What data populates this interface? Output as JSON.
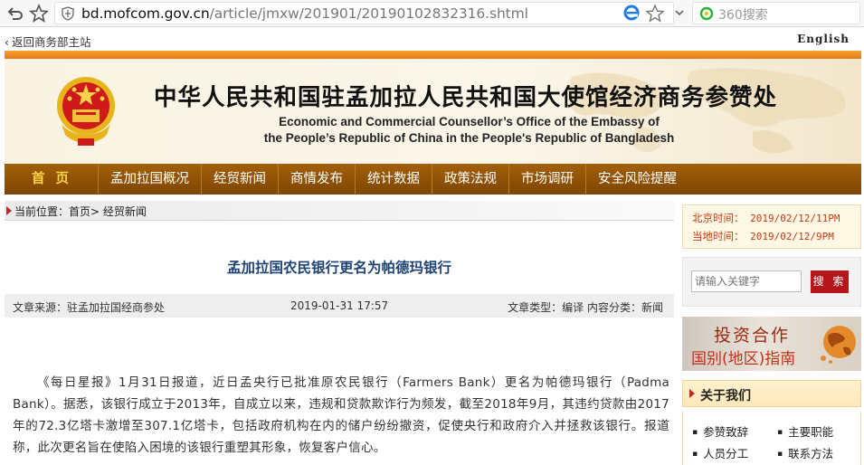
{
  "browser": {
    "url_host": "bd.mofcom.gov.cn",
    "url_path": "/article/jmxw/201901/20190102832316.shtml",
    "search_engine": "360搜索"
  },
  "top_links": {
    "back_home": "返回商务部主站",
    "english": "English"
  },
  "header": {
    "title_cn": "中华人民共和国驻孟加拉人民共和国大使馆经济商务参赞处",
    "title_en_line1": "Economic and Commercial Counsellor’s Office of the Embassy of",
    "title_en_line2": "the People’s Republic of China in the People's Republic of Bangladesh"
  },
  "nav": {
    "items": [
      "首页",
      "孟加拉国概况",
      "经贸新闻",
      "商情发布",
      "统计数据",
      "政策法规",
      "市场调研",
      "安全风险提醒"
    ],
    "active_index": 0,
    "active_color": "#ffd448"
  },
  "breadcrumb": {
    "text": "当前位置：首页> 经贸新闻"
  },
  "article": {
    "title": "孟加拉国农民银行更名为帕德玛银行",
    "source": "文章来源：驻孟加拉国经商参处",
    "date": "2019-01-31  17:57",
    "type": "文章类型：编译  内容分类：新闻",
    "body": "《每日星报》1月31日报道，近日孟央行已批准原农民银行（Farmers Bank）更名为帕德玛银行（Padma Bank）。据悉，该银行成立于2013年，自成立以来，违规和贷款欺诈行为频发，截至2018年9月，其违约贷款由2017年的72.3亿塔卡激增至307.1亿塔卡，包括政府机构在内的储户纷纷撤资，促使央行和政府介入并拯救该银行。报道称，此次更名旨在使陷入困境的该银行重塑其形象，恢复客户信心。"
  },
  "sidebar": {
    "beijing_label": "北京时间：",
    "beijing_time": "2019/02/12/11PM",
    "local_label": "当地时间：",
    "local_time": "2019/02/12/9PM",
    "search_placeholder": "请输入关键字",
    "search_button": "搜 索",
    "invest_line1": "投资合作",
    "invest_line2": "国别(地区)指南",
    "about_title": "关于我们",
    "about_items": [
      "参赞致辞",
      "主要职能",
      "人员分工",
      "联系方法"
    ]
  },
  "colors": {
    "nav_bg": "#8e5205",
    "accent_red": "#b4161b",
    "title_blue": "#1f4374",
    "banner_orange": "#f29a27"
  }
}
